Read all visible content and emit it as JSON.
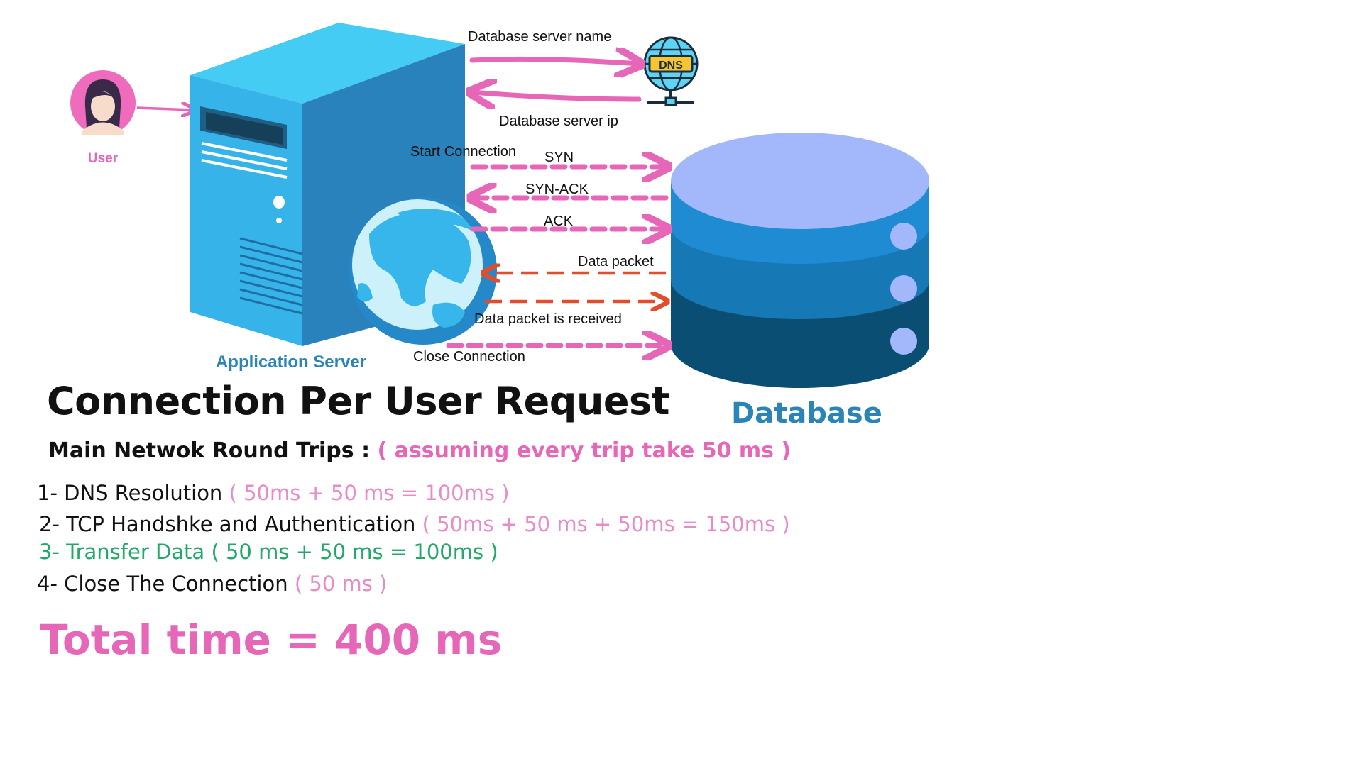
{
  "diagram": {
    "user_label": "User",
    "app_server_label": "Application Server",
    "dns_badge": "DNS",
    "database_label": "Database",
    "flows": {
      "dns_request": "Database server name",
      "dns_response": "Database server ip",
      "start_connection": "Start Connection",
      "syn": "SYN",
      "syn_ack": "SYN-ACK",
      "ack": "ACK",
      "data_packet": "Data packet",
      "data_received": "Data packet is received",
      "close_connection": "Close Connection"
    },
    "icons": [
      "user-avatar-icon",
      "server-icon",
      "globe-icon",
      "dns-globe-icon",
      "database-icon"
    ],
    "colors": {
      "pink": "#e667b8",
      "orange": "#e04e2c",
      "server_blue": "#3cc3f2",
      "db_top": "#a3b7fb",
      "green": "#22a869"
    }
  },
  "text": {
    "title": "Connection Per User Request",
    "subtitle": "Main Netwok Round Trips :",
    "subtitle_note": "( assuming every trip take 50 ms )",
    "items": [
      {
        "label": "1- DNS Resolution",
        "detail": "( 50ms + 50 ms = 100ms )"
      },
      {
        "label": "2- TCP Handshke and Authentication",
        "detail": "( 50ms + 50 ms + 50ms = 150ms )"
      },
      {
        "label": "3- Transfer Data",
        "detail": "( 50 ms + 50 ms = 100ms )"
      },
      {
        "label": "4- Close The Connection",
        "detail": "( 50 ms )"
      }
    ],
    "total": "Total time = 400 ms"
  }
}
